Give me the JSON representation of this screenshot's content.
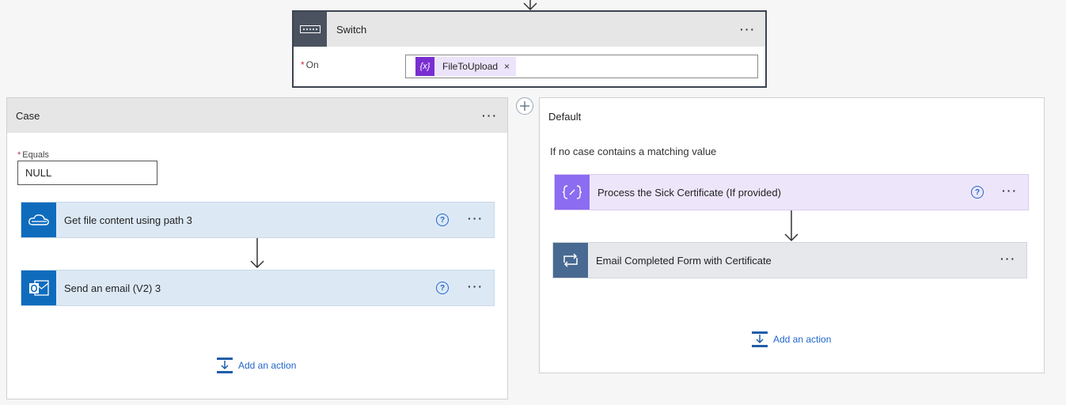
{
  "switch": {
    "title": "Switch",
    "on_label": "On",
    "required_mark": "*",
    "token": {
      "label": "FileToUpload",
      "icon": "variable-icon",
      "icon_text": "{x}",
      "remove": "×"
    },
    "menu": "···"
  },
  "case": {
    "title": "Case",
    "menu": "···",
    "equals_label": "Equals",
    "required_mark": "*",
    "equals_value": "NULL",
    "actions": [
      {
        "title": "Get file content using path 3",
        "icon": "onedrive-icon",
        "help": "?",
        "menu": "···"
      },
      {
        "title": "Send an email (V2) 3",
        "icon": "outlook-icon",
        "help": "?",
        "menu": "···"
      }
    ],
    "add_action": "Add an action"
  },
  "default": {
    "title": "Default",
    "description": "If no case contains a matching value",
    "actions": [
      {
        "title": "Process the Sick Certificate (If provided)",
        "icon": "scope-icon",
        "help": "?",
        "menu": "···"
      },
      {
        "title": "Email Completed Form with Certificate",
        "icon": "apply-to-each-icon",
        "menu": "···"
      }
    ],
    "add_action": "Add an action"
  },
  "colors": {
    "switch_icon_bg": "#4a5260",
    "variable_token": "#7a2ed1",
    "action_blue": "#0f6cbd",
    "scope_purple": "#8c6cf0",
    "loop_slate": "#486991",
    "link": "#2266cc"
  }
}
